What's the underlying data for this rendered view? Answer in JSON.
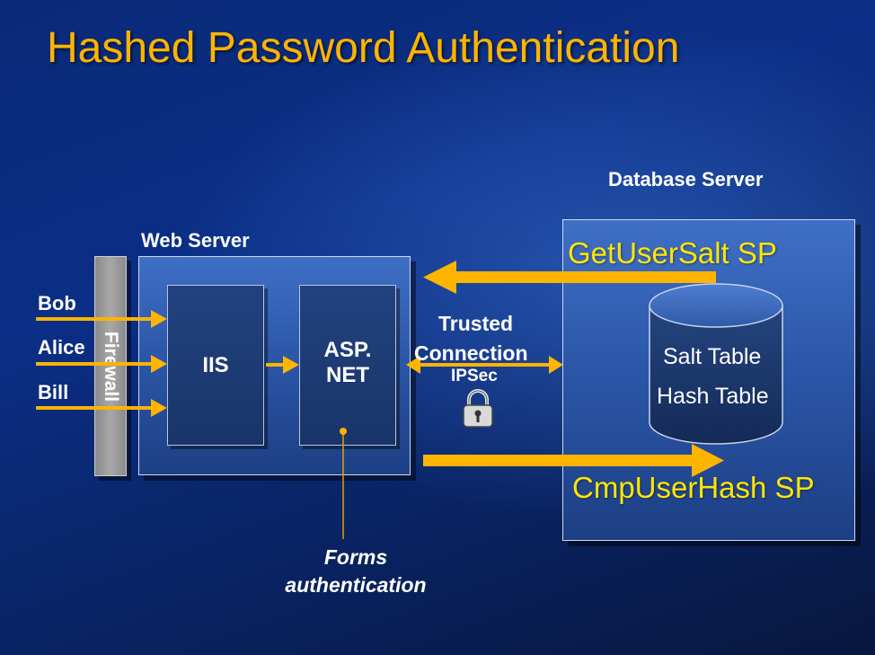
{
  "slide": {
    "title": "Hashed Password Authentication"
  },
  "web_server": {
    "label": "Web Server",
    "iis_label": "IIS",
    "aspnet_label_line1": "ASP.",
    "aspnet_label_line2": "NET"
  },
  "firewall": {
    "label": "Firewall"
  },
  "users": [
    "Bob",
    "Alice",
    "Bill"
  ],
  "connection": {
    "trusted_line1": "Trusted",
    "trusted_line2": "Connection",
    "ipsec": "IPSec",
    "lock_icon": "padlock-icon"
  },
  "database_server": {
    "label": "Database Server",
    "get_salt_sp": "GetUserSalt  SP",
    "cmp_hash_sp": "CmpUserHash  SP",
    "salt_table": "Salt Table",
    "hash_table": "Hash Table"
  },
  "forms_auth": {
    "line1": "Forms",
    "line2": "authentication"
  },
  "colors": {
    "title": "#ffb400",
    "arrow": "#ffb400",
    "sp_text": "#ffe600",
    "panel": "#2f5cb0",
    "inner_box": "#1f3d78",
    "firewall": "#9a9a9a"
  }
}
